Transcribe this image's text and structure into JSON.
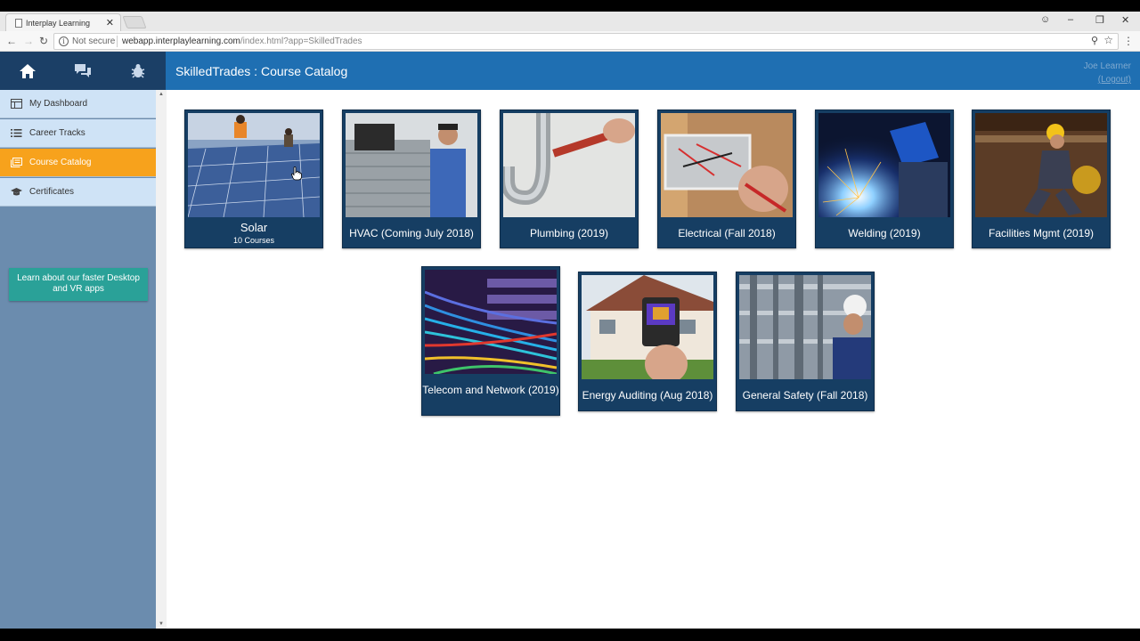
{
  "browser": {
    "tab_title": "Interplay Learning",
    "tab_close": "✕",
    "security_label": "Not secure",
    "url_host": "webapp.interplaylearning.com",
    "url_path": "/index.html?app=SkilledTrades"
  },
  "header": {
    "title": "SkilledTrades : Course Catalog",
    "user_name": "Joe Learner",
    "logout_label": "(Logout)"
  },
  "sidebar": {
    "items": [
      {
        "label": "My Dashboard",
        "icon": "dashboard-icon"
      },
      {
        "label": "Career Tracks",
        "icon": "list-icon"
      },
      {
        "label": "Course Catalog",
        "icon": "catalog-icon",
        "active": true
      },
      {
        "label": "Certificates",
        "icon": "graduation-cap-icon"
      }
    ],
    "promo": "Learn about our faster Desktop and VR apps"
  },
  "catalog": {
    "courses": [
      {
        "title": "Solar",
        "subtitle": "10 Courses"
      },
      {
        "title": "HVAC (Coming July 2018)"
      },
      {
        "title": "Plumbing (2019)"
      },
      {
        "title": "Electrical (Fall 2018)"
      },
      {
        "title": "Welding (2019)"
      },
      {
        "title": "Facilities Mgmt (2019)"
      },
      {
        "title": "Telecom and Network (2019)"
      },
      {
        "title": "Energy Auditing (Aug 2018)"
      },
      {
        "title": "General Safety (Fall 2018)"
      }
    ]
  },
  "colors": {
    "nav_dark": "#1b3f66",
    "header_blue": "#1f6fb2",
    "active_orange": "#f7a21c",
    "promo_teal": "#2aa198",
    "card_navy": "#163e63"
  }
}
